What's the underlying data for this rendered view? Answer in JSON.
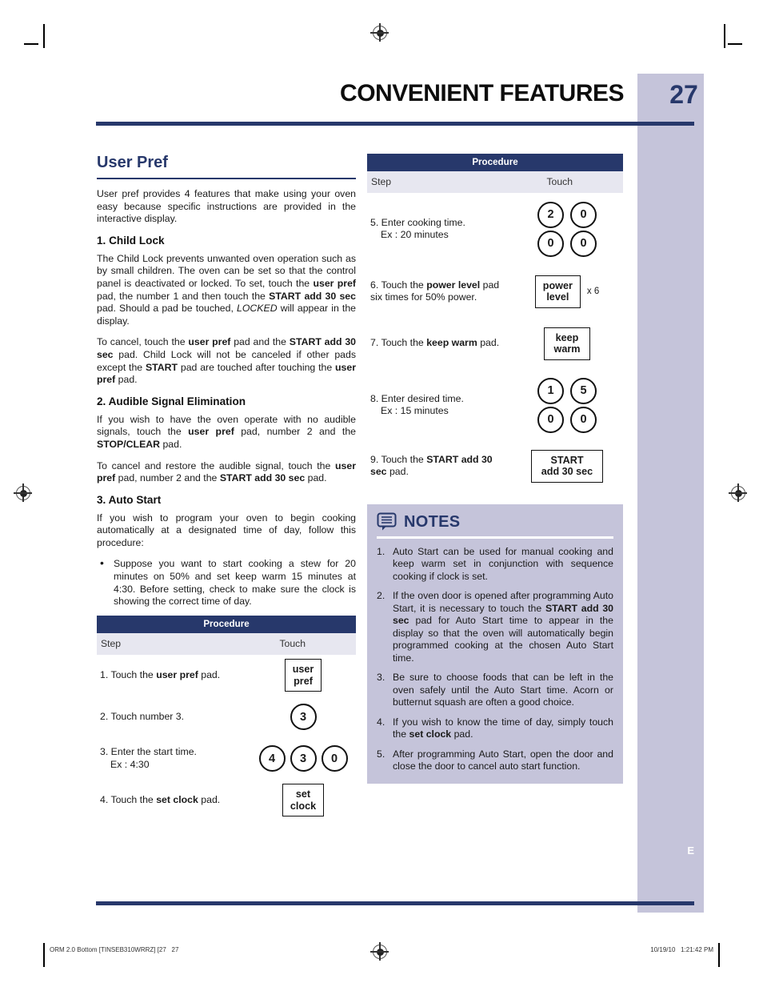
{
  "header": {
    "title": "CONVENIENT FEATURES",
    "page_number": "27"
  },
  "sidebar": {
    "letter": "E"
  },
  "left_column": {
    "section_title": "User Pref",
    "intro": "User pref provides 4 features that make using your oven easy because specific instructions are provided in the interactive display.",
    "sections": [
      {
        "heading": "1. Child Lock",
        "paragraph_1_pre": "The Child Lock prevents unwanted oven operation such as by small children. The oven can be set so that the control panel is deactivated or locked. To set, touch the ",
        "p1_b1": "user pref",
        "p1_mid1": " pad, the number 1 and then touch the ",
        "p1_b2": "START add 30 sec",
        "p1_mid2": " pad. Should a pad be touched, ",
        "p1_i1": "LOCKED",
        "p1_end": " will appear in the display.",
        "paragraph_2_pre": "To cancel, touch the ",
        "p2_b1": "user pref",
        "p2_mid1": " pad and the ",
        "p2_b2": "START add 30 sec",
        "p2_mid2": " pad. Child Lock will not be canceled if other pads except the ",
        "p2_b3": "START",
        "p2_mid3": " pad are touched after touching the ",
        "p2_b4": "user pref",
        "p2_end": " pad."
      },
      {
        "heading": "2. Audible Signal Elimination",
        "paragraph_1_pre": "If you wish to have the oven operate with no audible signals, touch the ",
        "p1_b1": "user pref",
        "p1_mid1": " pad, number 2 and the ",
        "p1_b2": "STOP/CLEAR",
        "p1_end": " pad.",
        "paragraph_2_pre": "To cancel and restore the audible signal, touch the ",
        "p2_b1": "user pref",
        "p2_mid1": " pad, number 2 and the ",
        "p2_b2": "START add 30 sec",
        "p2_end": " pad."
      },
      {
        "heading": "3. Auto Start",
        "paragraph_1": "If you wish to program your oven to begin cooking automatically at a designated time of day, follow this procedure:",
        "bullet_1": "Suppose you want to start cooking a stew for 20 minutes on 50% and set keep warm 15 minutes at 4:30. Before setting, check to make sure the clock is showing the correct time of day."
      }
    ],
    "table": {
      "title": "Procedure",
      "col_step": "Step",
      "col_touch": "Touch",
      "rows": [
        {
          "step_pre": "1. Touch the ",
          "step_b": "user pref",
          "step_post": " pad.",
          "keys": [
            {
              "type": "box",
              "lines": [
                "user",
                "pref"
              ]
            }
          ]
        },
        {
          "step_pre": "2. Touch number 3.",
          "step_b": "",
          "step_post": "",
          "keys": [
            {
              "type": "circle",
              "label": "3"
            }
          ]
        },
        {
          "step_pre": "3. Enter the start time.",
          "step_line2": "Ex : 4:30",
          "step_b": "",
          "step_post": "",
          "keys": [
            {
              "type": "circle",
              "label": "4"
            },
            {
              "type": "circle",
              "label": "3"
            },
            {
              "type": "circle",
              "label": "0"
            }
          ]
        },
        {
          "step_pre": "4. Touch the ",
          "step_b": "set clock",
          "step_post": " pad.",
          "keys": [
            {
              "type": "box",
              "lines": [
                "set",
                "clock"
              ]
            }
          ]
        }
      ]
    }
  },
  "right_column": {
    "table": {
      "title": "Procedure",
      "col_step": "Step",
      "col_touch": "Touch",
      "rows": [
        {
          "step_pre": "5. Enter cooking time.",
          "step_line2": "Ex : 20 minutes",
          "keys": [
            {
              "type": "circle",
              "label": "2"
            },
            {
              "type": "circle",
              "label": "0"
            },
            {
              "type": "circle",
              "label": "0"
            },
            {
              "type": "circle",
              "label": "0"
            }
          ]
        },
        {
          "step_pre": "6. Touch the ",
          "step_b": "power level",
          "step_post": " pad six times for 50% power.",
          "keys": [
            {
              "type": "box",
              "lines": [
                "power",
                "level"
              ]
            }
          ],
          "multiplier": "x 6"
        },
        {
          "step_pre": "7. Touch the ",
          "step_b": "keep warm",
          "step_post": " pad.",
          "keys": [
            {
              "type": "box",
              "lines": [
                "keep",
                "warm"
              ]
            }
          ]
        },
        {
          "step_pre": "8. Enter desired time.",
          "step_line2": "Ex : 15 minutes",
          "keys": [
            {
              "type": "circle",
              "label": "1"
            },
            {
              "type": "circle",
              "label": "5"
            },
            {
              "type": "circle",
              "label": "0"
            },
            {
              "type": "circle",
              "label": "0"
            }
          ]
        },
        {
          "step_pre": "9. Touch the ",
          "step_b": "START add 30 sec",
          "step_post": " pad.",
          "keys": [
            {
              "type": "box",
              "lines": [
                "START",
                "add 30 sec"
              ]
            }
          ]
        }
      ]
    },
    "notes": {
      "title": "NOTES",
      "icon": "notes-bubble-icon",
      "items": [
        {
          "pre": "Auto Start can be used for manual cooking and keep warm set in conjunction with sequence cooking if clock is set.",
          "bold": "",
          "post": ""
        },
        {
          "pre": "If the oven door is opened after programming Auto Start, it is necessary to touch the ",
          "bold": "START add 30 sec",
          "post": " pad for Auto Start time to appear in the display so that the oven will automatically begin programmed cooking at the chosen Auto Start time."
        },
        {
          "pre": "Be sure to choose foods that can be left in the oven safely until the Auto Start time. Acorn or butternut squash are often a good choice.",
          "bold": "",
          "post": ""
        },
        {
          "pre": "If you wish to know the time of day, simply touch the ",
          "bold": "set clock",
          "post": " pad."
        },
        {
          "pre": "After programming Auto Start, open the door and close the door to cancel auto start function.",
          "bold": "",
          "post": ""
        }
      ]
    }
  },
  "print_footer": {
    "left": "ORM 2.0 Bottom [TINSEB310WRRZ] [27   27",
    "right": "10/19/10   1:21:42 PM"
  },
  "colors": {
    "navy": "#27386b",
    "lavender": "#c5c4da",
    "subhead": "#e7e7f0",
    "white": "#ffffff"
  }
}
